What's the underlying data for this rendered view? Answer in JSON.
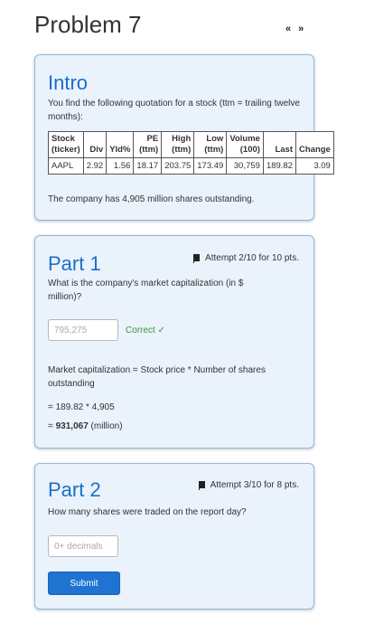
{
  "problem": {
    "title": "Problem 7",
    "prev_symbol": "«",
    "next_symbol": "»"
  },
  "intro": {
    "title": "Intro",
    "text": "You find the following quotation for a stock (ttm = trailing twelve months):",
    "table": {
      "headers": [
        [
          "Stock",
          "(ticker)"
        ],
        [
          "Div",
          ""
        ],
        [
          "Yld%",
          ""
        ],
        [
          "PE",
          "(ttm)"
        ],
        [
          "High",
          "(ttm)"
        ],
        [
          "Low",
          "(ttm)"
        ],
        [
          "Volume",
          "(100)"
        ],
        [
          "Last",
          ""
        ],
        [
          "Change",
          ""
        ]
      ],
      "row": [
        "AAPL",
        "2.92",
        "1.56",
        "18.17",
        "203.75",
        "173.49",
        "30,759",
        "189.82",
        "3.09"
      ]
    },
    "note": "The company has 4,905 million shares outstanding."
  },
  "part1": {
    "title": "Part 1",
    "attempt": "Attempt 2/10 for 10 pts.",
    "question": "What is the company's market capitalization (in $ million)?",
    "answer_value": "795,275",
    "feedback": "Correct ✓",
    "solution_line1": "Market capitalization = Stock price * Number of shares outstanding",
    "solution_line2": "= 189.82 * 4,905",
    "solution_result": "931,067",
    "solution_unit": " (million)"
  },
  "part2": {
    "title": "Part 2",
    "attempt": "Attempt 3/10 for 8 pts.",
    "question": "How many shares were traded on the report day?",
    "placeholder": "0+ decimals",
    "submit_label": "Submit"
  }
}
